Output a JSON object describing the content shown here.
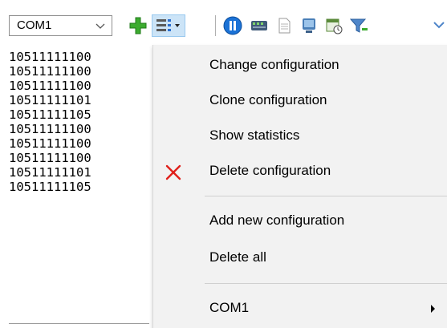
{
  "toolbar": {
    "port_select": {
      "value": "COM1"
    },
    "icons": [
      "add-icon",
      "configuration-menu-icon",
      "pause-icon",
      "device-icon",
      "document-icon",
      "terminal-icon",
      "schedule-icon",
      "filter-icon"
    ]
  },
  "data_lines": [
    "10511111100",
    "10511111100",
    "10511111100",
    "10511111101",
    "10511111105",
    "10511111100",
    "10511111100",
    "10511111100",
    "10511111101",
    "10511111105"
  ],
  "context_menu": {
    "items": [
      {
        "label": "Change configuration"
      },
      {
        "label": "Clone configuration"
      },
      {
        "label": "Show statistics"
      },
      {
        "label": "Delete configuration",
        "icon": "delete-x-icon"
      },
      {
        "label": "Add new configuration"
      },
      {
        "label": "Delete all"
      },
      {
        "label": "COM1",
        "has_submenu": true
      }
    ]
  },
  "colors": {
    "add_icon": "#3cab2f",
    "pause_icon": "#1b72d6",
    "delete_icon": "#e0201b",
    "pressed_button": "#cce4f7",
    "menu_background": "#f2f2f2"
  }
}
